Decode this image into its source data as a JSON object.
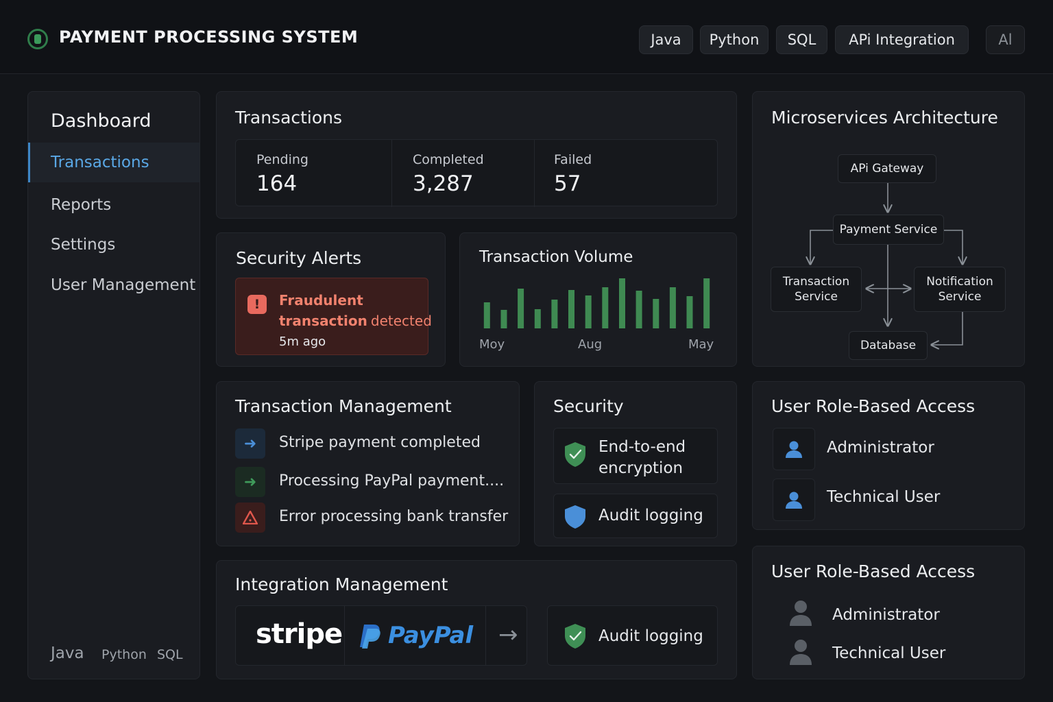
{
  "app": {
    "title": "PAYMENT PROCESSING SYSTEM"
  },
  "header": {
    "chips": [
      "Java",
      "Python",
      "SQL",
      "APi Integration",
      "Al"
    ]
  },
  "sidebar": {
    "title": "Dashboard",
    "items": [
      {
        "label": "Transactions",
        "active": true
      },
      {
        "label": "Reports",
        "active": false
      },
      {
        "label": "Settings",
        "active": false
      },
      {
        "label": "User Management",
        "active": false
      }
    ],
    "footer": [
      "Java",
      "Python",
      "SQL"
    ]
  },
  "transactions": {
    "title": "Transactions",
    "stats": [
      {
        "label": "Pending",
        "value": "164"
      },
      {
        "label": "Completed",
        "value": "3,287"
      },
      {
        "label": "Failed",
        "value": "57"
      }
    ]
  },
  "security_alerts": {
    "title": "Security Alerts",
    "alert_bold_line1": "Fraudulent",
    "alert_bold_line2": "transaction",
    "alert_rest": "detected",
    "alert_time": "5m ago"
  },
  "volume": {
    "title": "Transaction Volume",
    "tick_labels": [
      "Moy",
      "Aug",
      "May"
    ]
  },
  "chart_data": {
    "type": "bar",
    "title": "Transaction Volume",
    "categories": [
      "Moy",
      "",
      "",
      "",
      "",
      "",
      "Aug",
      "",
      "",
      "",
      "",
      "",
      "",
      "May"
    ],
    "values": [
      38,
      27,
      58,
      28,
      42,
      56,
      48,
      60,
      73,
      55,
      43,
      60,
      47,
      73
    ],
    "ylim": [
      0,
      80
    ],
    "color": "#3f8a52",
    "grid": false
  },
  "transaction_management": {
    "title": "Transaction Management",
    "items": [
      {
        "text": "Stripe payment completed",
        "icon": "arrow-right-icon",
        "color": "#4a8fd8"
      },
      {
        "text": "Processing PayPal payment....",
        "icon": "arrow-right-icon",
        "color": "#3f9a5a"
      },
      {
        "text": "Error processing bank transfer",
        "icon": "warning-icon",
        "color": "#e0574c"
      }
    ]
  },
  "security": {
    "title": "Security",
    "items": [
      {
        "line1": "End-to-end",
        "line2": "encryption",
        "icon": "shield-check-icon"
      },
      {
        "line1": "Audit logging",
        "icon": "shield-icon"
      }
    ]
  },
  "architecture": {
    "title": "Microservices Architecture",
    "nodes": {
      "gateway": "APi Gateway",
      "payment": "Payment Service",
      "transaction_l1": "Transaction",
      "transaction_l2": "Service",
      "notification_l1": "Notification",
      "notification_l2": "Service",
      "database": "Database"
    }
  },
  "roles_1": {
    "title": "User Role-Based Access",
    "items": [
      "Administrator",
      "Technical User"
    ]
  },
  "roles_2": {
    "title": "User Role-Based Access",
    "items": [
      "Administrator",
      "Technical User"
    ]
  },
  "integration": {
    "title": "Integration Management",
    "stripe": "stripe",
    "paypal": "PayPal",
    "audit": "Audit logging"
  },
  "colors": {
    "accent_blue": "#5aa8e6",
    "success_green": "#3f9a5a",
    "danger_red": "#e86a5e",
    "background": "#131519"
  }
}
